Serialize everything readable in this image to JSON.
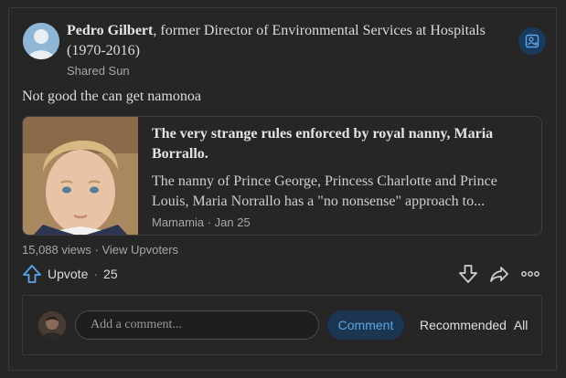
{
  "author": {
    "name": "Pedro Gilbert",
    "credential": ", former Director of Environmental Services at Hospitals (1970-2016)",
    "shared": "Shared Sun"
  },
  "post": {
    "text": "Not good the can get namonoa"
  },
  "link_card": {
    "title": "The very strange rules enforced by royal nanny, Maria Borrallo.",
    "description": "The nanny of Prince George, Princess Charlotte and Prince Louis, Maria Norrallo has a \"no nonsense\" approach to...",
    "source": "Mamamia",
    "dot": "·",
    "date": "Jan 25"
  },
  "stats": {
    "views": "15,088 views",
    "separator": "·",
    "upvoters_link": "View Upvoters"
  },
  "actions": {
    "upvote_label": "Upvote",
    "separator": "·",
    "upvote_count": "25",
    "icons": [
      "upvote-icon",
      "downvote-icon",
      "share-icon",
      "more-icon"
    ]
  },
  "comment": {
    "placeholder": "Add a comment...",
    "button_label": "Comment",
    "sort_label": "Recommended",
    "sort_value": "All"
  },
  "colors": {
    "background": "#262626",
    "accent": "#5aa6e8",
    "muted_text": "#a7a7a7"
  }
}
